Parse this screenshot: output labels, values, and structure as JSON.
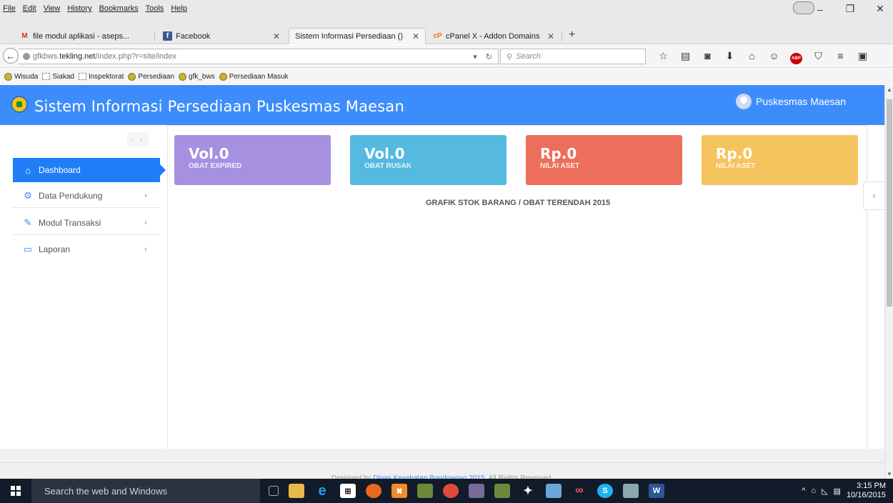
{
  "browser": {
    "menus": [
      "File",
      "Edit",
      "View",
      "History",
      "Bookmarks",
      "Tools",
      "Help"
    ],
    "tabs": [
      {
        "label": "file modul aplikasi - aseps...",
        "icon": "gmail-icon"
      },
      {
        "label": "Facebook",
        "icon": "facebook-icon"
      },
      {
        "label": "Sistem Informasi Persediaan ()",
        "icon": "none"
      },
      {
        "label": "cPanel X - Addon Domains",
        "icon": "cpanel-icon"
      }
    ],
    "url_host": "gfkbws.tekling.net",
    "url_path": "/index.php?r=site/index",
    "url_prefix": "gfkbws.",
    "url_domain": "tekling.net",
    "search_placeholder": "Search",
    "bookmarks": [
      "Wisuda",
      "Siakad",
      "Inspektorat",
      "Persediaan",
      "gfk_bws",
      "Persediaan Masuk"
    ]
  },
  "app": {
    "title": "Sistem Informasi Persediaan Puskesmas Maesan",
    "user_name": "Puskesmas Maesan",
    "sidebar": [
      {
        "label": "Dashboard",
        "icon": "home-icon",
        "active": true
      },
      {
        "label": "Data Pendukung",
        "icon": "gear-icon",
        "active": false
      },
      {
        "label": "Modul Transaksi",
        "icon": "edit-icon",
        "active": false
      },
      {
        "label": "Laporan",
        "icon": "monitor-icon",
        "active": false
      }
    ],
    "cards": [
      {
        "value": "Vol.0",
        "label": "OBAT EXPIRED",
        "color": "#a690e0"
      },
      {
        "value": "Vol.0",
        "label": "OBAT RUSAK",
        "color": "#55b9e0"
      },
      {
        "value": "Rp.0",
        "label": "NILAI ASET",
        "color": "#ec6f5b"
      },
      {
        "value": "Rp.0",
        "label": "NILAI ASET",
        "color": "#f5c45e"
      }
    ],
    "chart_title": "GRAFIK STOK BARANG / OBAT TERENDAH 2015",
    "footer_prefix": "Designed by ",
    "footer_link": "Dinas Kesehatan Bondowoso 2015",
    "footer_suffix": ". All Rights Reserved.",
    "accent": "#3c8dfb"
  },
  "taskbar": {
    "search_placeholder": "Search the web and Windows",
    "time": "3:15 PM",
    "date": "10/16/2015"
  }
}
